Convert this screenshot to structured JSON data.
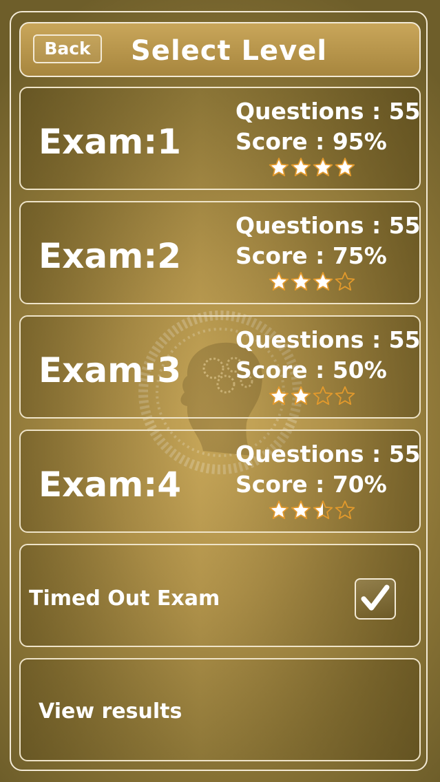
{
  "header": {
    "back_label": "Back",
    "title": "Select Level"
  },
  "exams": [
    {
      "name": "Exam:1",
      "questions": "Questions : 55",
      "score": "Score : 95%",
      "rating": 4.0
    },
    {
      "name": "Exam:2",
      "questions": "Questions : 55",
      "score": "Score : 75%",
      "rating": 3.0
    },
    {
      "name": "Exam:3",
      "questions": "Questions : 55",
      "score": "Score : 50%",
      "rating": 2.0
    },
    {
      "name": "Exam:4",
      "questions": "Questions : 55",
      "score": "Score : 70%",
      "rating": 2.5
    }
  ],
  "timed": {
    "label": "Timed Out Exam",
    "checked": true
  },
  "view_results": {
    "label": "View results"
  },
  "colors": {
    "star_fill": "#ffffff",
    "star_outline": "#e39a2c",
    "border": "#f3ead6"
  }
}
